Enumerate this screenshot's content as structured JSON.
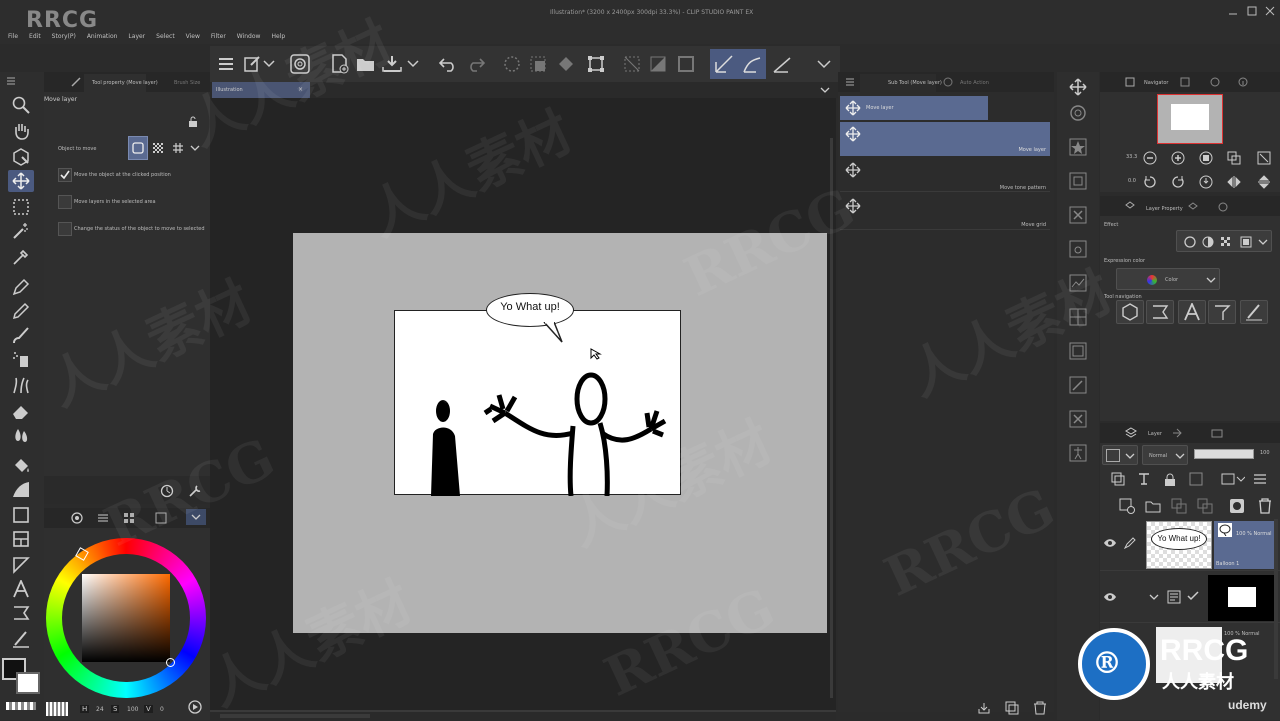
{
  "titlebar": {
    "title": "Illustration* (3200 x 2400px 300dpi 33.3%) - CLIP STUDIO PAINT EX",
    "logo": "RRCG"
  },
  "menu": [
    "File",
    "Edit",
    "Story(P)",
    "Animation",
    "Layer",
    "Select",
    "View",
    "Filter",
    "Window",
    "Help"
  ],
  "tabs": {
    "tool_property": "Tool property (Move layer)",
    "brush_size": "Brush Size",
    "sub_tool": "Sub Tool (Move layer)",
    "auto_action": "Auto Action",
    "canvas_tab": "Illustration",
    "navigator": "Navigator",
    "layer_property": "Layer Property",
    "layer": "Layer"
  },
  "tool_property": {
    "header": "Move layer",
    "object_label": "Object to move",
    "options": [
      {
        "label": "Move the object at the clicked position",
        "checked": true
      },
      {
        "label": "Move layers in the selected area",
        "checked": false
      },
      {
        "label": "Change the status of the object to move to selected",
        "checked": false
      }
    ]
  },
  "color": {
    "h_label": "H",
    "h": "24",
    "s_label": "S",
    "s": "100",
    "v_label": "V",
    "v": "0"
  },
  "canvas": {
    "speech": "Yo What up!"
  },
  "subtools": [
    {
      "label": "Move layer",
      "selected": true
    },
    {
      "label": "Move layer",
      "selected": true
    },
    {
      "label": "Move tone pattern",
      "selected": false
    },
    {
      "label": "Move grid",
      "selected": false
    }
  ],
  "navigator": {
    "zoom": "33.3",
    "angle": "0.0"
  },
  "layer_property": {
    "effect_label": "Effect",
    "expression_label": "Expression color",
    "expression_value": "Color",
    "toolnav_label": "Tool navigation"
  },
  "layers": {
    "blend_mode": "Normal",
    "opacity": "100",
    "items": [
      {
        "thumb_text": "Yo What up!",
        "info": "100 % Normal",
        "name": "Balloon 1"
      },
      {
        "info": "",
        "name": ""
      },
      {
        "info": "100 % Normal",
        "name": ""
      }
    ]
  },
  "watermark": {
    "brand": "RRCG",
    "sub": "人人素材",
    "site": "udemy"
  },
  "accent": "#5a6a91"
}
